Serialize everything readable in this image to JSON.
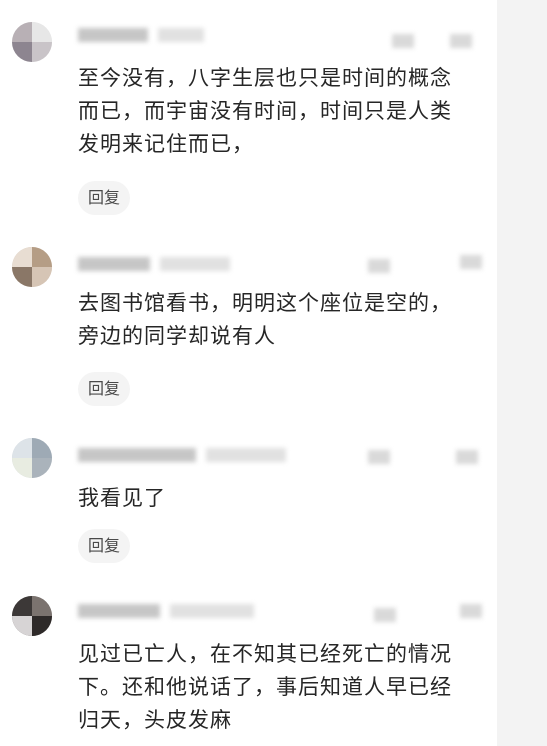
{
  "comments": [
    {
      "lines": [
        "至今没有，八字生层也只是时间的概念",
        "而已，而宇宙没有时间，时间只是人类",
        "发明来记住而已，"
      ],
      "reply_label": "回复"
    },
    {
      "lines": [
        "去图书馆看书，明明这个座位是空的，",
        "旁边的同学却说有人"
      ],
      "reply_label": "回复"
    },
    {
      "lines": [
        "我看见了"
      ],
      "reply_label": "回复"
    },
    {
      "lines": [
        "见过已亡人，在不知其已经死亡的情况",
        "下。还和他说话了，事后知道人早已经",
        "归天，头皮发麻"
      ],
      "reply_label": null
    }
  ],
  "colors": {
    "text": "#262626",
    "reply_bg": "#f4f4f4",
    "reply_text": "#4a4a4a",
    "page_bg": "#f3f3f3",
    "card_bg": "#ffffff"
  },
  "icons": [
    "like-icon-blurred",
    "more-icon-blurred"
  ]
}
